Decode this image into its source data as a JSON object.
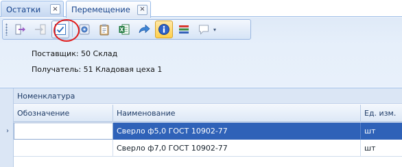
{
  "tabs": [
    {
      "label": "Остатки",
      "close": "×"
    },
    {
      "label": "Перемещение",
      "close": "×"
    }
  ],
  "toolbar": {
    "buttons": [
      {
        "icon": "export-arrow-icon"
      },
      {
        "icon": "import-arrow-icon"
      },
      {
        "icon": "checkmark-icon",
        "highlighted": true
      },
      {
        "icon": "settings-icon"
      },
      {
        "icon": "clipboard-icon"
      },
      {
        "icon": "excel-icon"
      },
      {
        "icon": "forward-arrow-icon"
      },
      {
        "icon": "info-icon",
        "pressed": true
      },
      {
        "icon": "layers-icon"
      },
      {
        "icon": "speech-bubble-icon"
      }
    ],
    "dropdown_glyph": "▾",
    "accent_color": "#e01a1a"
  },
  "info": {
    "supplier": "Поставщик:  50 Склад",
    "receiver": "Получатель: 51 Кладовая цеха 1"
  },
  "grid": {
    "group_header": "Номенклатура",
    "columns": [
      "Обозначение",
      "Наименование",
      "Ед. изм."
    ],
    "rows": [
      {
        "designation": "",
        "name": "Сверло ф5,0 ГОСТ 10902-77",
        "unit": "шт",
        "selected": true
      },
      {
        "designation": "",
        "name": "Сверло ф7,0 ГОСТ 10902-77",
        "unit": "шт",
        "selected": false
      }
    ],
    "current_row_marker": "›",
    "selection_color": "#2f62b8"
  }
}
